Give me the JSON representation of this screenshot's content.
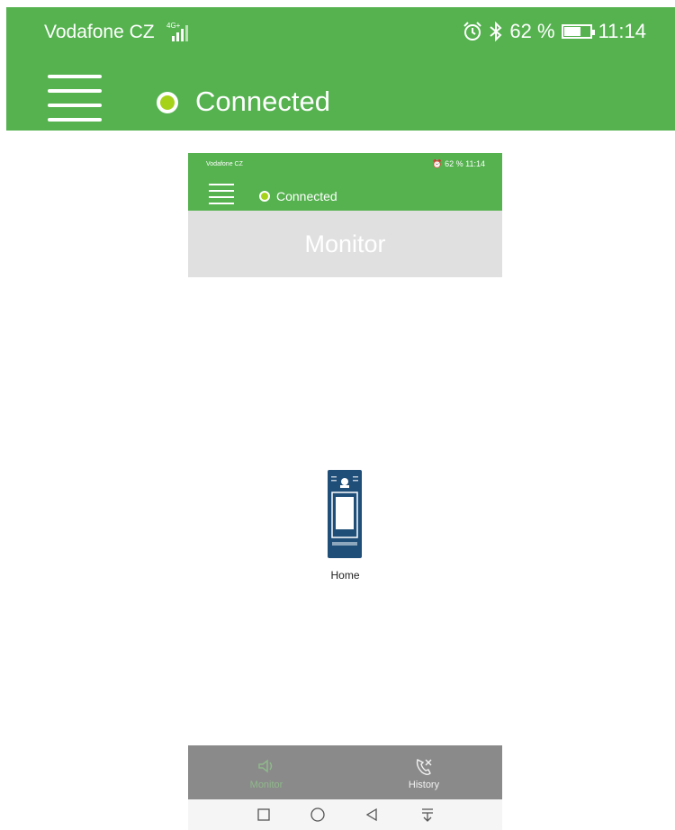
{
  "status_bar": {
    "carrier": "Vodafone CZ",
    "network": "4G+",
    "battery": "62 %",
    "time": "11:14"
  },
  "header": {
    "connection_status": "Connected",
    "menu_icon": "hamburger-menu-icon",
    "status_dot_color": "#a6d21a",
    "bar_color": "#55b24f"
  },
  "phone": {
    "status_bar": {
      "carrier": "Vodafone CZ",
      "battery": "62 %",
      "time": "11:14"
    },
    "header": {
      "connection_status": "Connected"
    },
    "page_title": "Monitor",
    "device": {
      "label": "Home",
      "icon": "door-intercom-icon"
    },
    "bottom_nav": [
      {
        "label": "Monitor",
        "icon": "speaker-monitor-icon",
        "active": true
      },
      {
        "label": "History",
        "icon": "phone-history-icon",
        "active": false
      }
    ],
    "system_nav": [
      "square-recents-icon",
      "circle-home-icon",
      "triangle-back-icon",
      "notification-down-icon"
    ]
  }
}
